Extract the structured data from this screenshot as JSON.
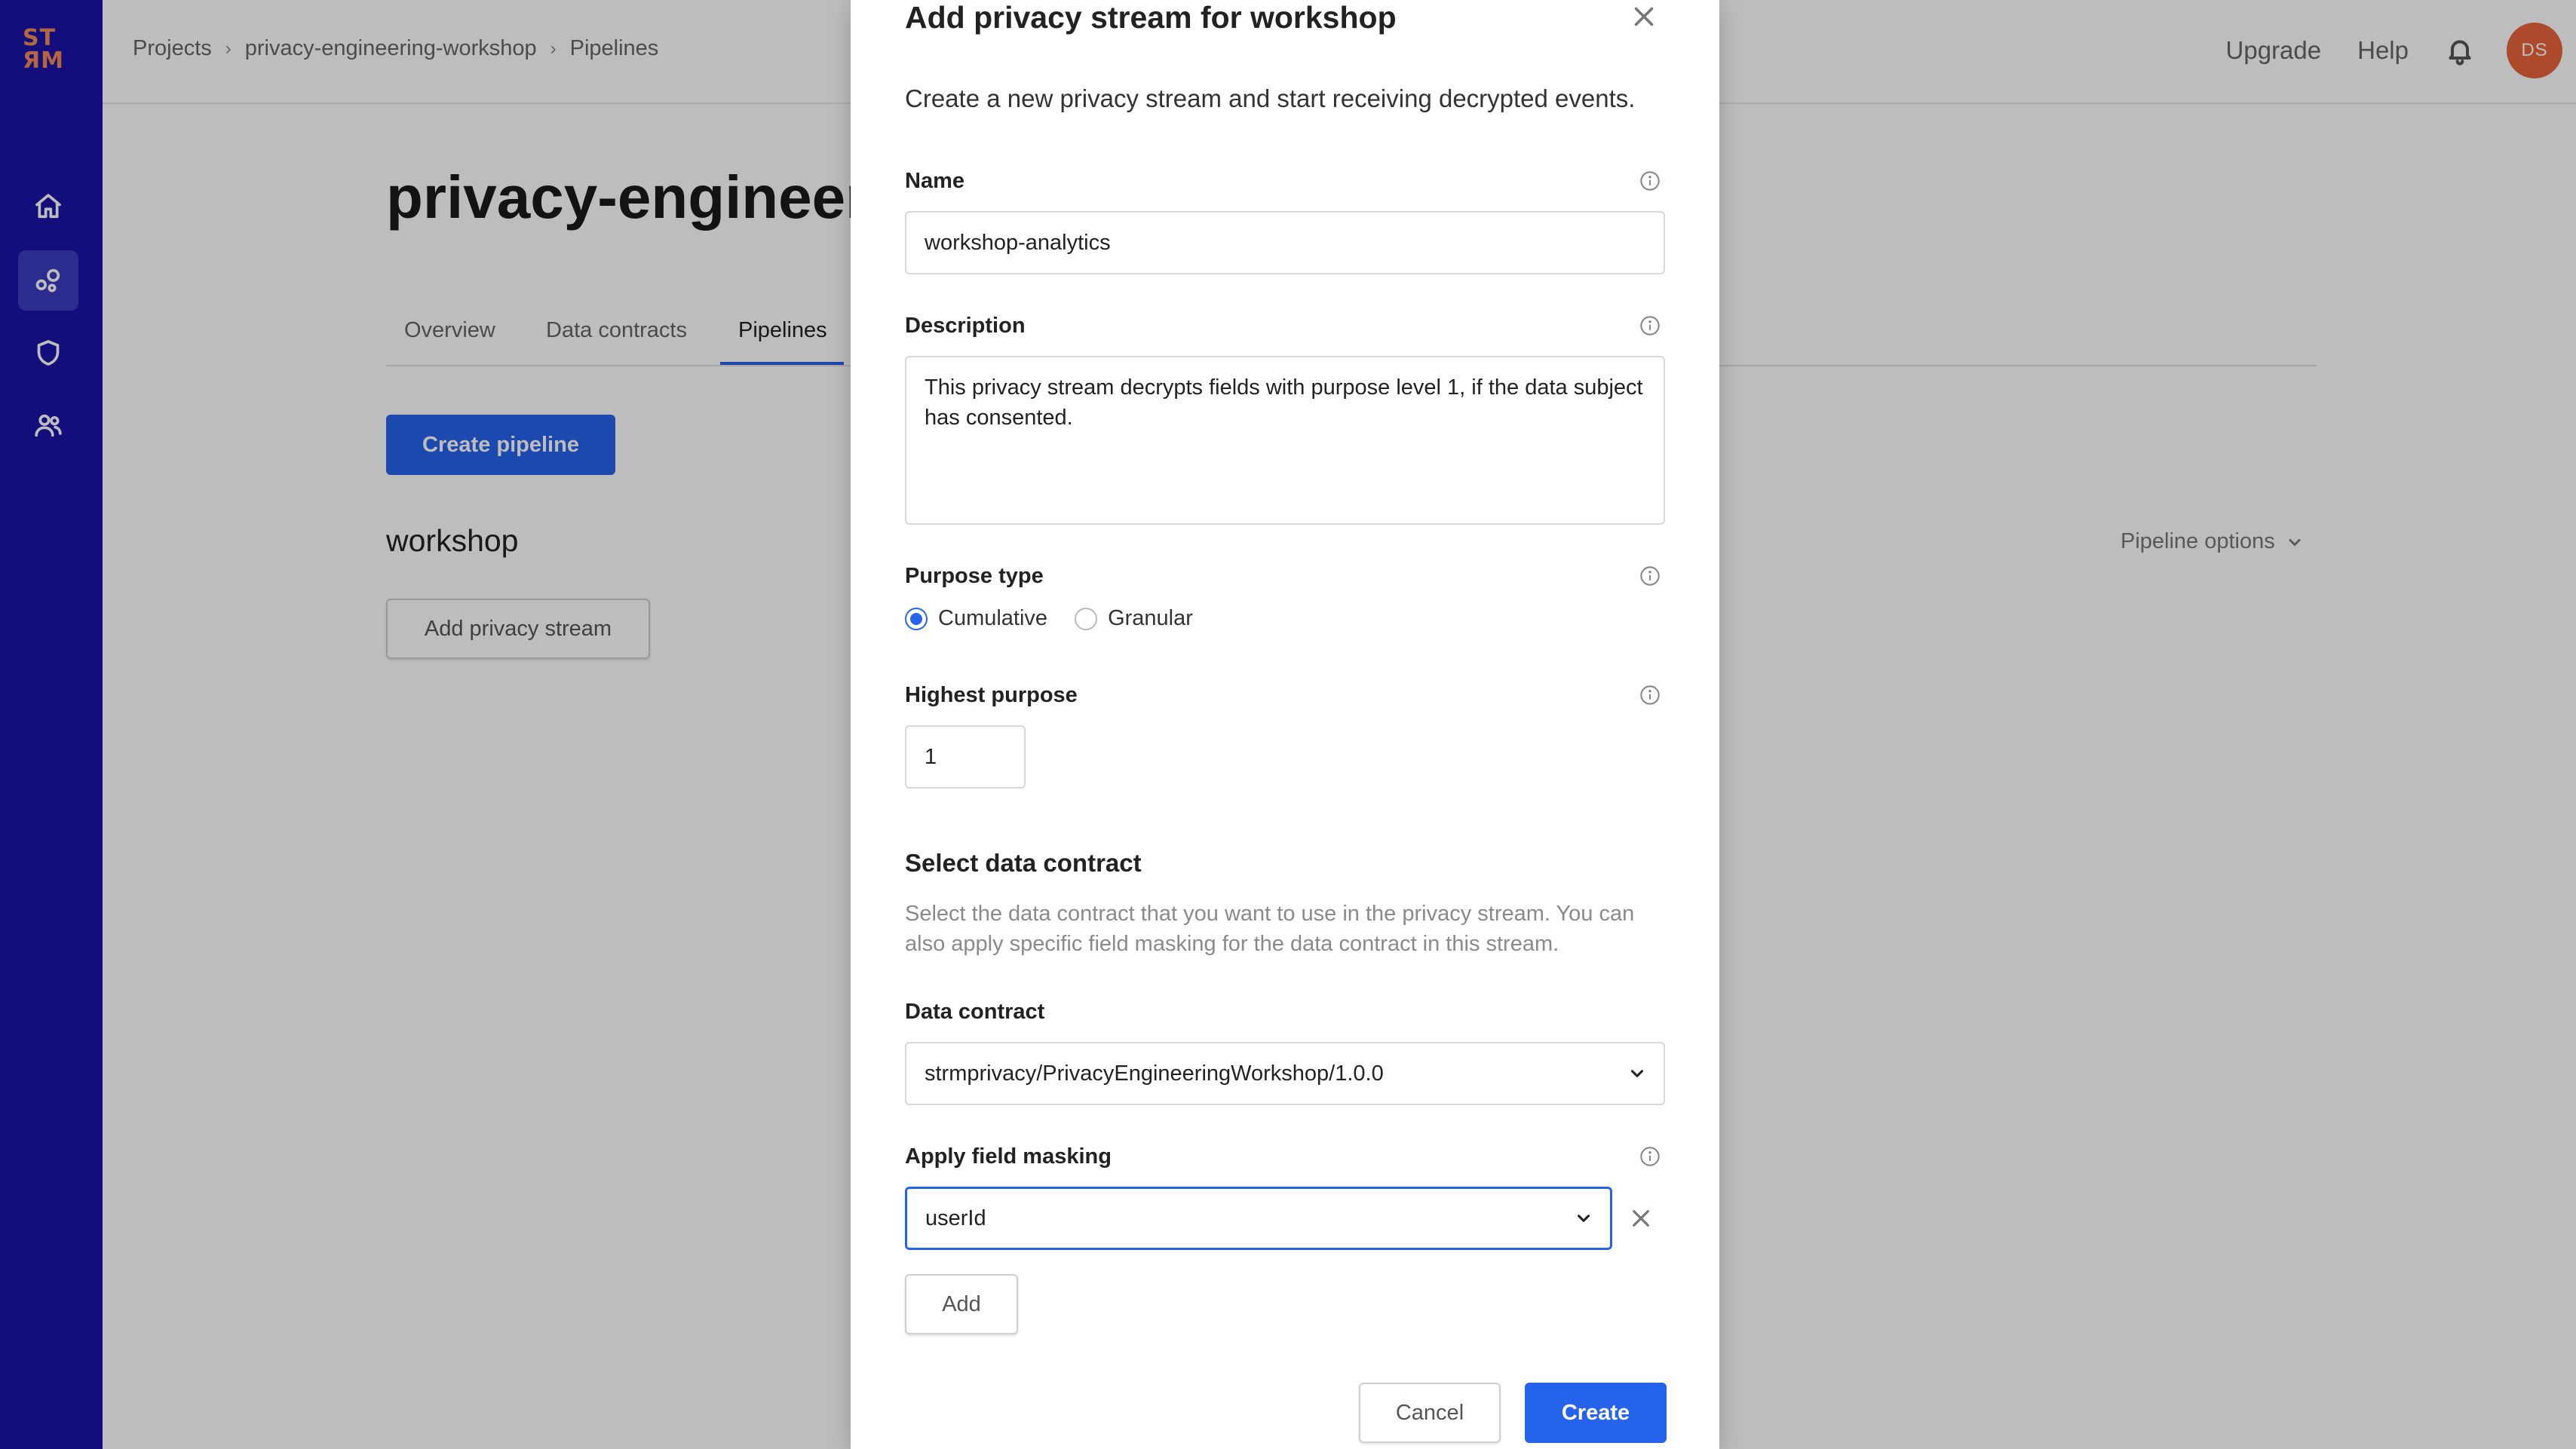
{
  "logo": {
    "line1": "ST",
    "line2": "ЯM"
  },
  "sidebar": {
    "items": [
      {
        "name": "home",
        "icon": "home-icon"
      },
      {
        "name": "pipelines",
        "icon": "pipelines-icon",
        "active": true
      },
      {
        "name": "security",
        "icon": "shield-icon"
      },
      {
        "name": "team",
        "icon": "users-icon"
      }
    ]
  },
  "header": {
    "breadcrumb": [
      "Projects",
      "privacy-engineering-workshop",
      "Pipelines"
    ],
    "upgrade_label": "Upgrade",
    "help_label": "Help",
    "avatar_initials": "DS"
  },
  "page": {
    "title": "privacy-engineeri",
    "tabs": [
      "Overview",
      "Data contracts",
      "Pipelines"
    ],
    "active_tab": "Pipelines",
    "create_pipeline_label": "Create pipeline",
    "pipeline_name": "workshop",
    "add_privacy_stream_label": "Add privacy stream",
    "pipeline_options_label": "Pipeline options"
  },
  "modal": {
    "title": "Add privacy stream for workshop",
    "subtitle": "Create a new privacy stream and start receiving decrypted events.",
    "name_label": "Name",
    "name_value": "workshop-analytics",
    "description_label": "Description",
    "description_value": "This privacy stream decrypts fields with purpose level 1, if the data subject has consented.",
    "purpose_type_label": "Purpose type",
    "purpose_options": [
      "Cumulative",
      "Granular"
    ],
    "purpose_selected": "Cumulative",
    "highest_purpose_label": "Highest purpose",
    "highest_purpose_value": "1",
    "select_contract_heading": "Select data contract",
    "select_contract_help": "Select the data contract that you want to use in the privacy stream. You can also apply specific field masking for the data contract in this stream.",
    "data_contract_label": "Data contract",
    "data_contract_value": "strmprivacy/PrivacyEngineeringWorkshop/1.0.0",
    "field_masking_label": "Apply field masking",
    "field_masking_value": "userId",
    "add_label": "Add",
    "cancel_label": "Cancel",
    "create_label": "Create"
  },
  "colors": {
    "sidebar": "#1a14a8",
    "accent": "#2563eb",
    "avatar": "#e8663a",
    "logo": "#f08b57"
  }
}
